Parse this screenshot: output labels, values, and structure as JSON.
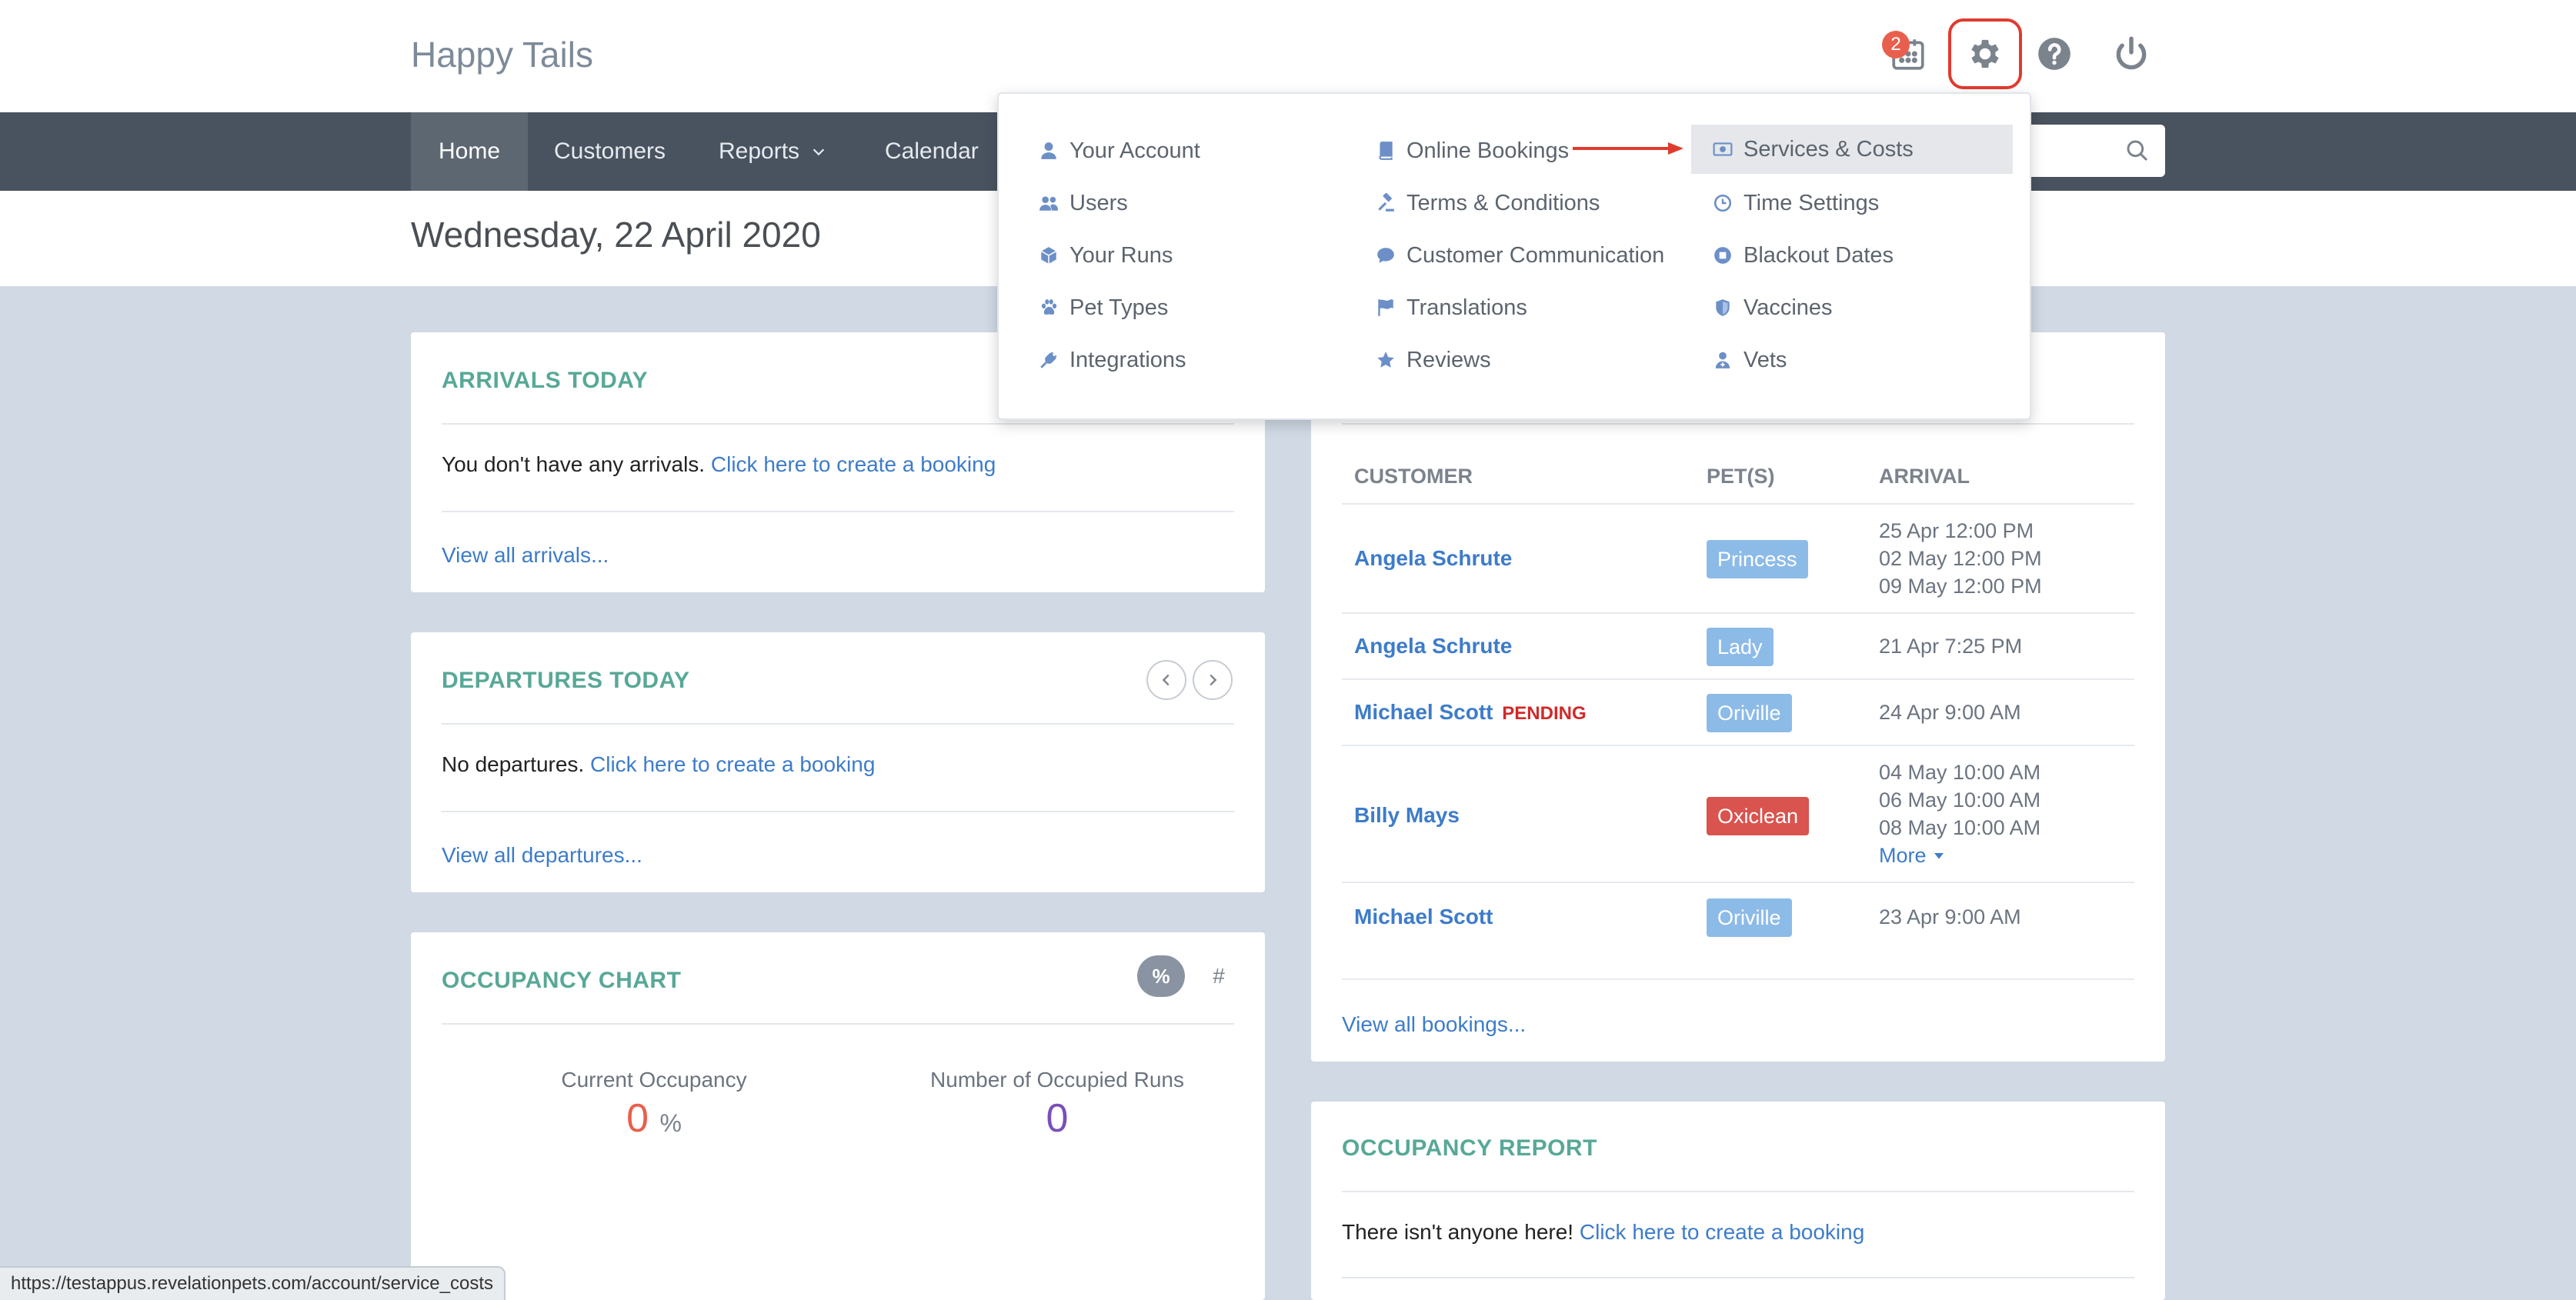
{
  "header": {
    "brand": "Happy Tails",
    "notification_count": "2",
    "accent": "#e03b2f"
  },
  "nav": {
    "items": [
      "Home",
      "Customers",
      "Reports",
      "Calendar"
    ],
    "active": "Home"
  },
  "page": {
    "date_title": "Wednesday, 22 April 2020"
  },
  "arrivals": {
    "title": "ARRIVALS TODAY",
    "empty_text": "You don't have any arrivals.",
    "create_link": "Click here to create a booking",
    "view_all": "View all arrivals..."
  },
  "departures": {
    "title": "DEPARTURES TODAY",
    "empty_text": "No departures.",
    "create_link": "Click here to create a booking",
    "view_all": "View all departures..."
  },
  "occupancy_chart": {
    "title": "OCCUPANCY CHART",
    "toggle_percent": "%",
    "toggle_number": "#",
    "current_label": "Current Occupancy",
    "current_value": "0",
    "current_unit": "%",
    "runs_label": "Number of Occupied Runs",
    "runs_value": "0"
  },
  "bookings": {
    "columns": [
      "CUSTOMER",
      "PET(S)",
      "ARRIVAL"
    ],
    "rows": [
      {
        "customer": "Angela Schrute",
        "pending": "",
        "pet": "Princess",
        "pet_color": "#8dbbe8",
        "arrivals": [
          "25 Apr 12:00 PM",
          "02 May 12:00 PM",
          "09 May 12:00 PM"
        ]
      },
      {
        "customer": "Angela Schrute",
        "pending": "",
        "pet": "Lady",
        "pet_color": "#8dbbe8",
        "arrivals": [
          "21 Apr 7:25 PM"
        ]
      },
      {
        "customer": "Michael Scott",
        "pending": "PENDING",
        "pet": "Oriville",
        "pet_color": "#8dbbe8",
        "arrivals": [
          "24 Apr 9:00 AM"
        ]
      },
      {
        "customer": "Billy Mays",
        "pending": "",
        "pet": "Oxiclean",
        "pet_color": "#d9534f",
        "arrivals": [
          "04 May 10:00 AM",
          "06 May 10:00 AM",
          "08 May 10:00 AM"
        ],
        "more": "More"
      },
      {
        "customer": "Michael Scott",
        "pending": "",
        "pet": "Oriville",
        "pet_color": "#8dbbe8",
        "arrivals": [
          "23 Apr 9:00 AM"
        ]
      }
    ],
    "view_all": "View all bookings..."
  },
  "occupancy_report": {
    "title": "OCCUPANCY REPORT",
    "empty_text": "There isn't anyone here!",
    "create_link": "Click here to create a booking"
  },
  "settings_menu": {
    "col1": [
      {
        "label": "Your Account",
        "icon": "user-icon"
      },
      {
        "label": "Users",
        "icon": "users-icon"
      },
      {
        "label": "Your Runs",
        "icon": "cube-icon"
      },
      {
        "label": "Pet Types",
        "icon": "paw-icon"
      },
      {
        "label": "Integrations",
        "icon": "plug-icon"
      }
    ],
    "col2": [
      {
        "label": "Online Bookings",
        "icon": "book-icon"
      },
      {
        "label": "Terms & Conditions",
        "icon": "gavel-icon"
      },
      {
        "label": "Customer Communication",
        "icon": "comment-icon"
      },
      {
        "label": "Translations",
        "icon": "flag-icon"
      },
      {
        "label": "Reviews",
        "icon": "star-icon"
      }
    ],
    "col3": [
      {
        "label": "Services & Costs",
        "icon": "money-icon"
      },
      {
        "label": "Time Settings",
        "icon": "clock-icon"
      },
      {
        "label": "Blackout Dates",
        "icon": "stop-icon"
      },
      {
        "label": "Vaccines",
        "icon": "shield-icon"
      },
      {
        "label": "Vets",
        "icon": "doctor-icon"
      }
    ],
    "highlighted": "Services & Costs"
  },
  "status_bar": {
    "url": "https://testappus.revelationpets.com/account/service_costs"
  }
}
